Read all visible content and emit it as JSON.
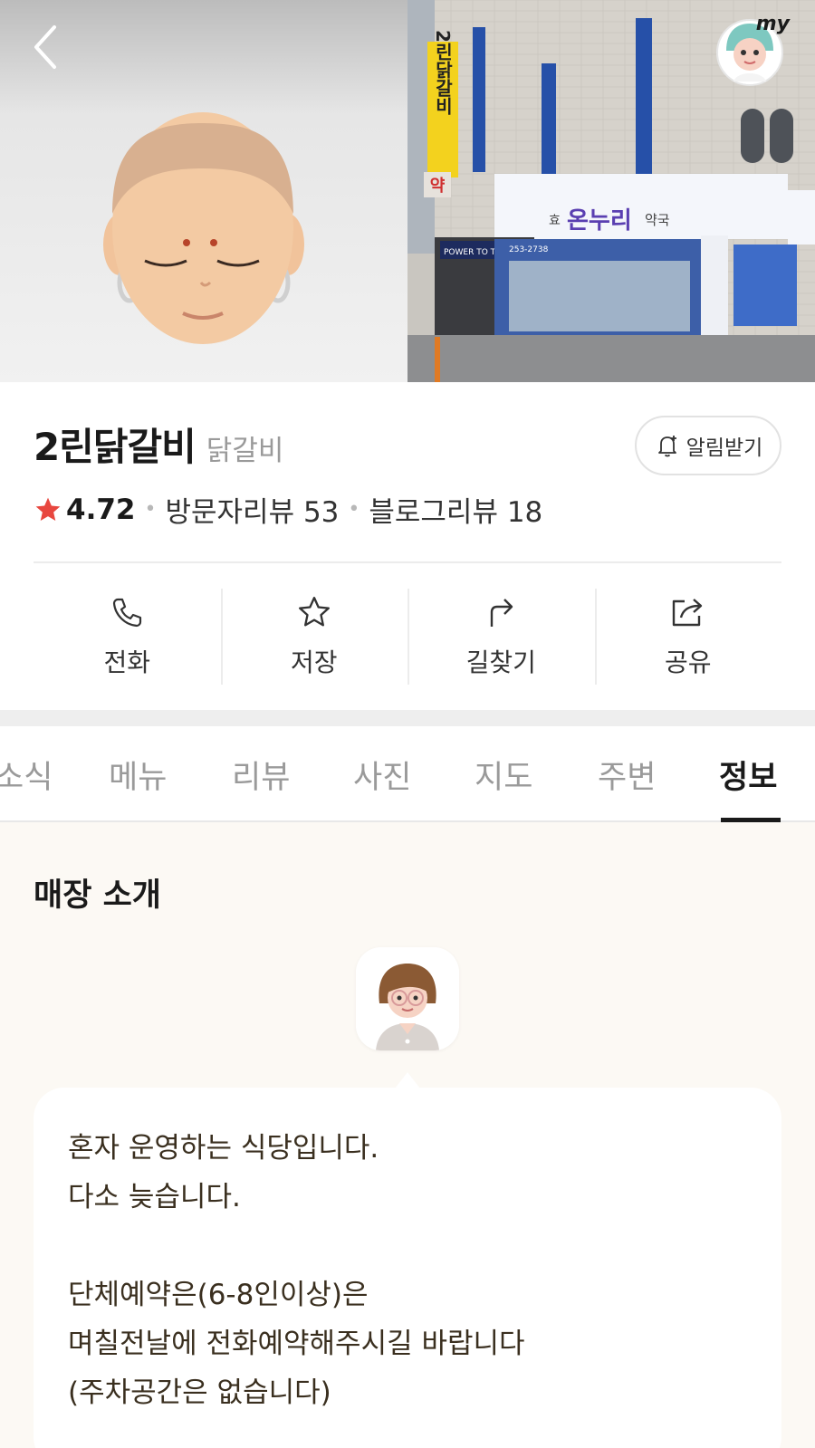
{
  "store": {
    "name": "2린닭갈비",
    "category": "닭갈비",
    "rating": "4.72",
    "visitor_reviews": "방문자리뷰 53",
    "blog_reviews": "블로그리뷰 18",
    "notify_label": "알림받기",
    "my_badge": "my"
  },
  "hero": {
    "left_icon": "memoji-avatar",
    "right_photo": "storefront-photo",
    "sign_vertical": "2린닭갈비",
    "sign_shop": "온누리",
    "sign_shop_prefix": "효",
    "sign_shop_suffix": "약국",
    "sign_pharmacy_small": "약",
    "sign_banner": "POWER TO THE PEOPLE",
    "sign_phone": "253-2738"
  },
  "actions": [
    {
      "label": "전화",
      "icon": "phone-icon"
    },
    {
      "label": "저장",
      "icon": "star-icon"
    },
    {
      "label": "길찾기",
      "icon": "directions-icon"
    },
    {
      "label": "공유",
      "icon": "share-icon"
    }
  ],
  "tabs": [
    {
      "label": "소식"
    },
    {
      "label": "메뉴"
    },
    {
      "label": "리뷰"
    },
    {
      "label": "사진"
    },
    {
      "label": "지도"
    },
    {
      "label": "주변"
    },
    {
      "label": "정보"
    }
  ],
  "active_tab": "정보",
  "intro": {
    "title": "매장 소개",
    "lines": [
      "혼자 운영하는 식당입니다.",
      "다소 늦습니다.",
      "",
      "단체예약은(6-8인이상)은",
      "며칠전날에 전화예약해주시길 바랍니다",
      "(주차공간은 없습니다)"
    ]
  },
  "colors": {
    "star": "#e8473f",
    "text": "#1a1a1a",
    "muted": "#9a9a9a",
    "content_bg": "#fcf9f4",
    "bubble_text": "#3a2f1f"
  }
}
